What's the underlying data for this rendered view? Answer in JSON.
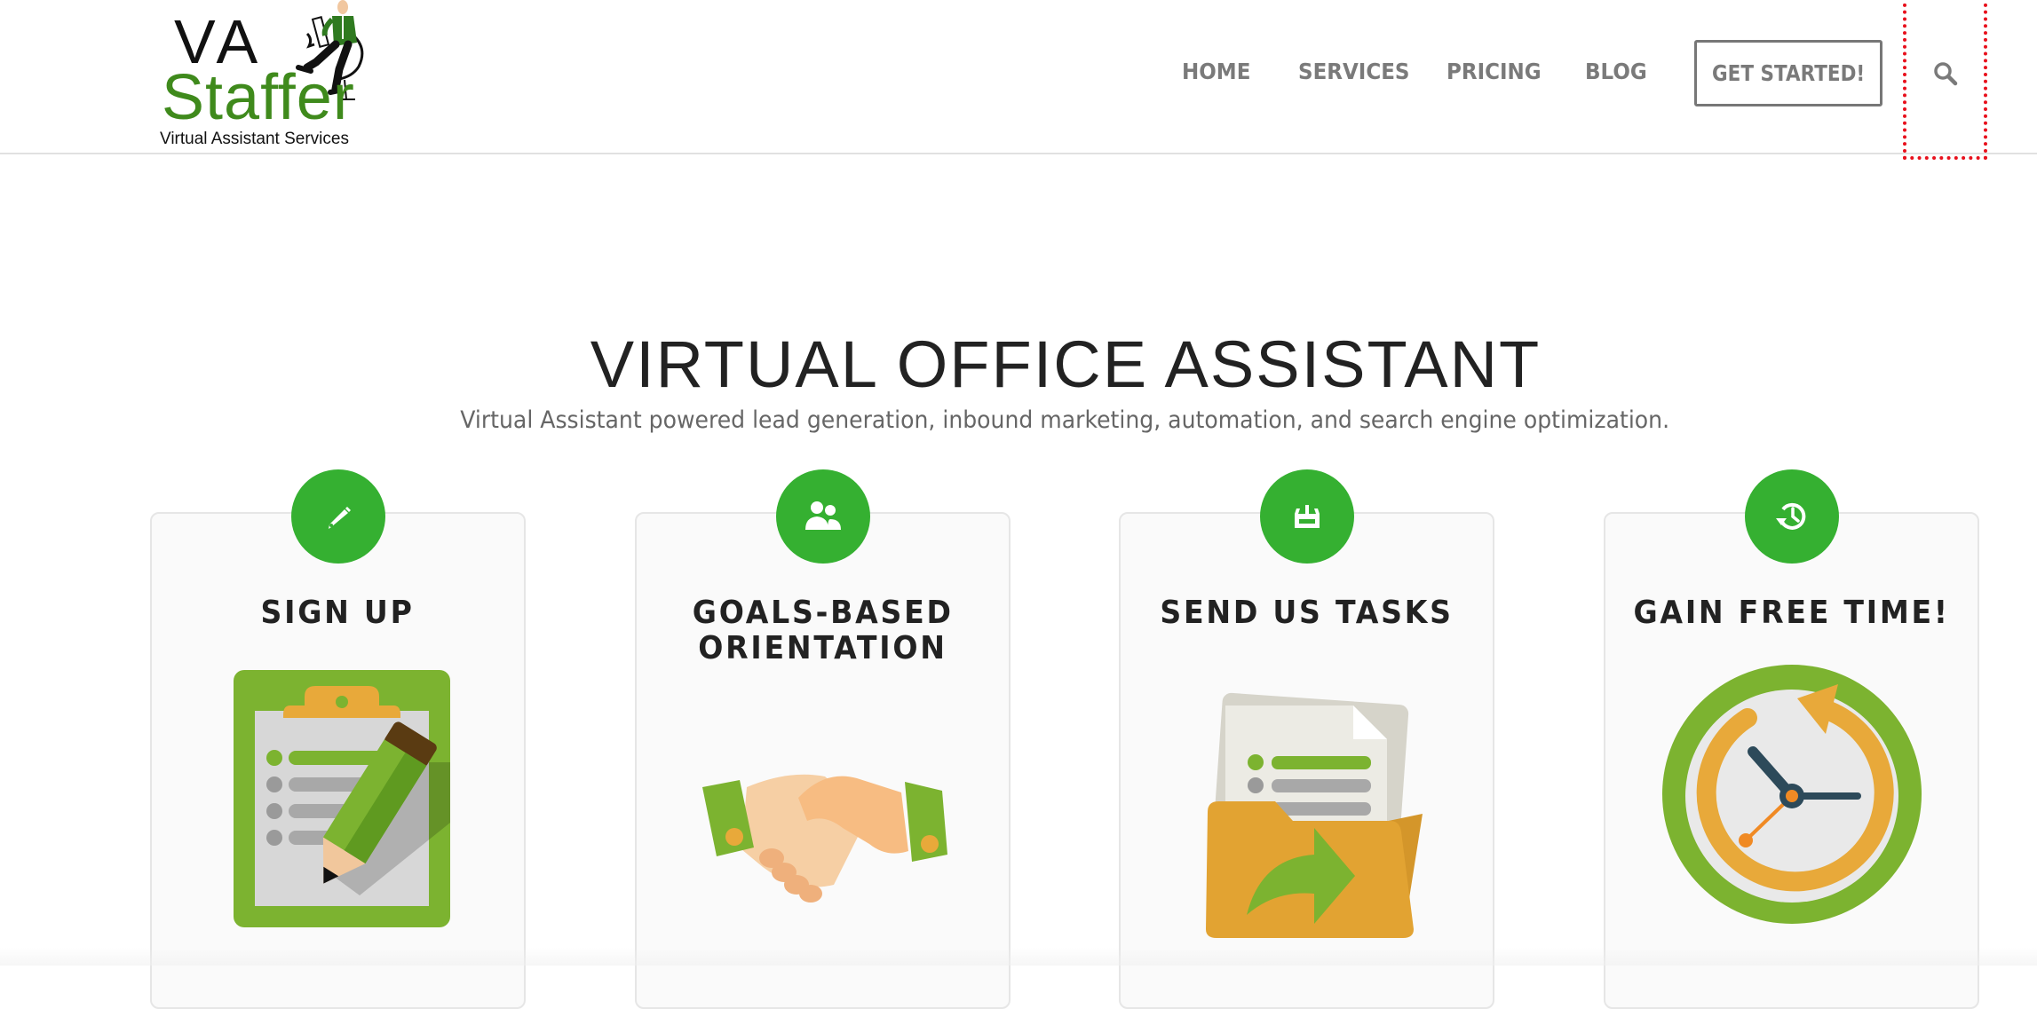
{
  "brand": {
    "logo_line1": "VA",
    "logo_line2": "Staffer",
    "logo_tagline": "Virtual Assistant Services",
    "accent_green": "#35b031",
    "logo_green": "#3f8a1c"
  },
  "nav": {
    "items": [
      {
        "label": "HOME"
      },
      {
        "label": "SERVICES"
      },
      {
        "label": "PRICING"
      },
      {
        "label": "BLOG"
      }
    ],
    "cta_label": "GET STARTED!",
    "search_icon": "search-icon",
    "search_highlight_color": "#e8101c"
  },
  "hero": {
    "title": "VIRTUAL OFFICE ASSISTANT",
    "subtitle": "Virtual Assistant powered lead generation, inbound marketing, automation, and search engine optimization."
  },
  "steps": [
    {
      "title_lines": [
        "SIGN UP"
      ],
      "icon": "pencil-icon",
      "illustration": "clipboard-pencil-illustration"
    },
    {
      "title_lines": [
        "GOALS-BASED",
        "ORIENTATION"
      ],
      "icon": "users-icon",
      "illustration": "handshake-illustration"
    },
    {
      "title_lines": [
        "SEND US TASKS"
      ],
      "icon": "inbox-download-icon",
      "illustration": "folder-documents-illustration"
    },
    {
      "title_lines": [
        "GAIN FREE TIME!"
      ],
      "icon": "history-clock-icon",
      "illustration": "clock-illustration"
    }
  ]
}
